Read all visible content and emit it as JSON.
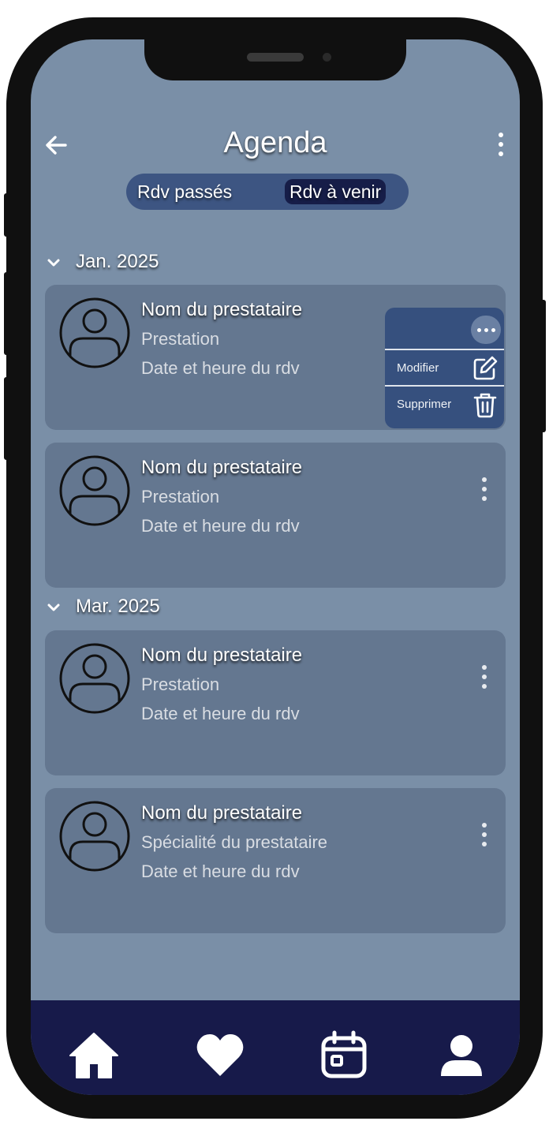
{
  "header": {
    "title": "Agenda"
  },
  "tabs": {
    "past": "Rdv passés",
    "upcoming": "Rdv à venir",
    "active": "upcoming"
  },
  "sections": [
    {
      "title": "Jan. 2025"
    },
    {
      "title": "Mar. 2025"
    }
  ],
  "cards": [
    {
      "name": "Nom du prestataire",
      "line1": "Prestation",
      "line2": "Date et heure du rdv",
      "menu_open": true
    },
    {
      "name": "Nom du prestataire",
      "line1": "Prestation",
      "line2": "Date et heure du rdv",
      "menu_open": false
    },
    {
      "name": "Nom du prestataire",
      "line1": "Prestation",
      "line2": "Date et heure du rdv",
      "menu_open": false
    },
    {
      "name": "Nom du prestataire",
      "line1": "Spécialité du prestataire",
      "line2": "Date et heure du rdv",
      "menu_open": false
    }
  ],
  "context_menu": {
    "edit": "Modifier",
    "delete": "Supprimer"
  },
  "bottom_nav": [
    "home-icon",
    "heart-icon",
    "calendar-icon",
    "user-icon"
  ],
  "colors": {
    "screen_bg": "#7a8fa7",
    "card_bg": "#647790",
    "toggle_bg": "#3d5582",
    "active_tab": "#161d48",
    "menu_bg": "#36507e",
    "bottom_bar": "#171a4a"
  }
}
